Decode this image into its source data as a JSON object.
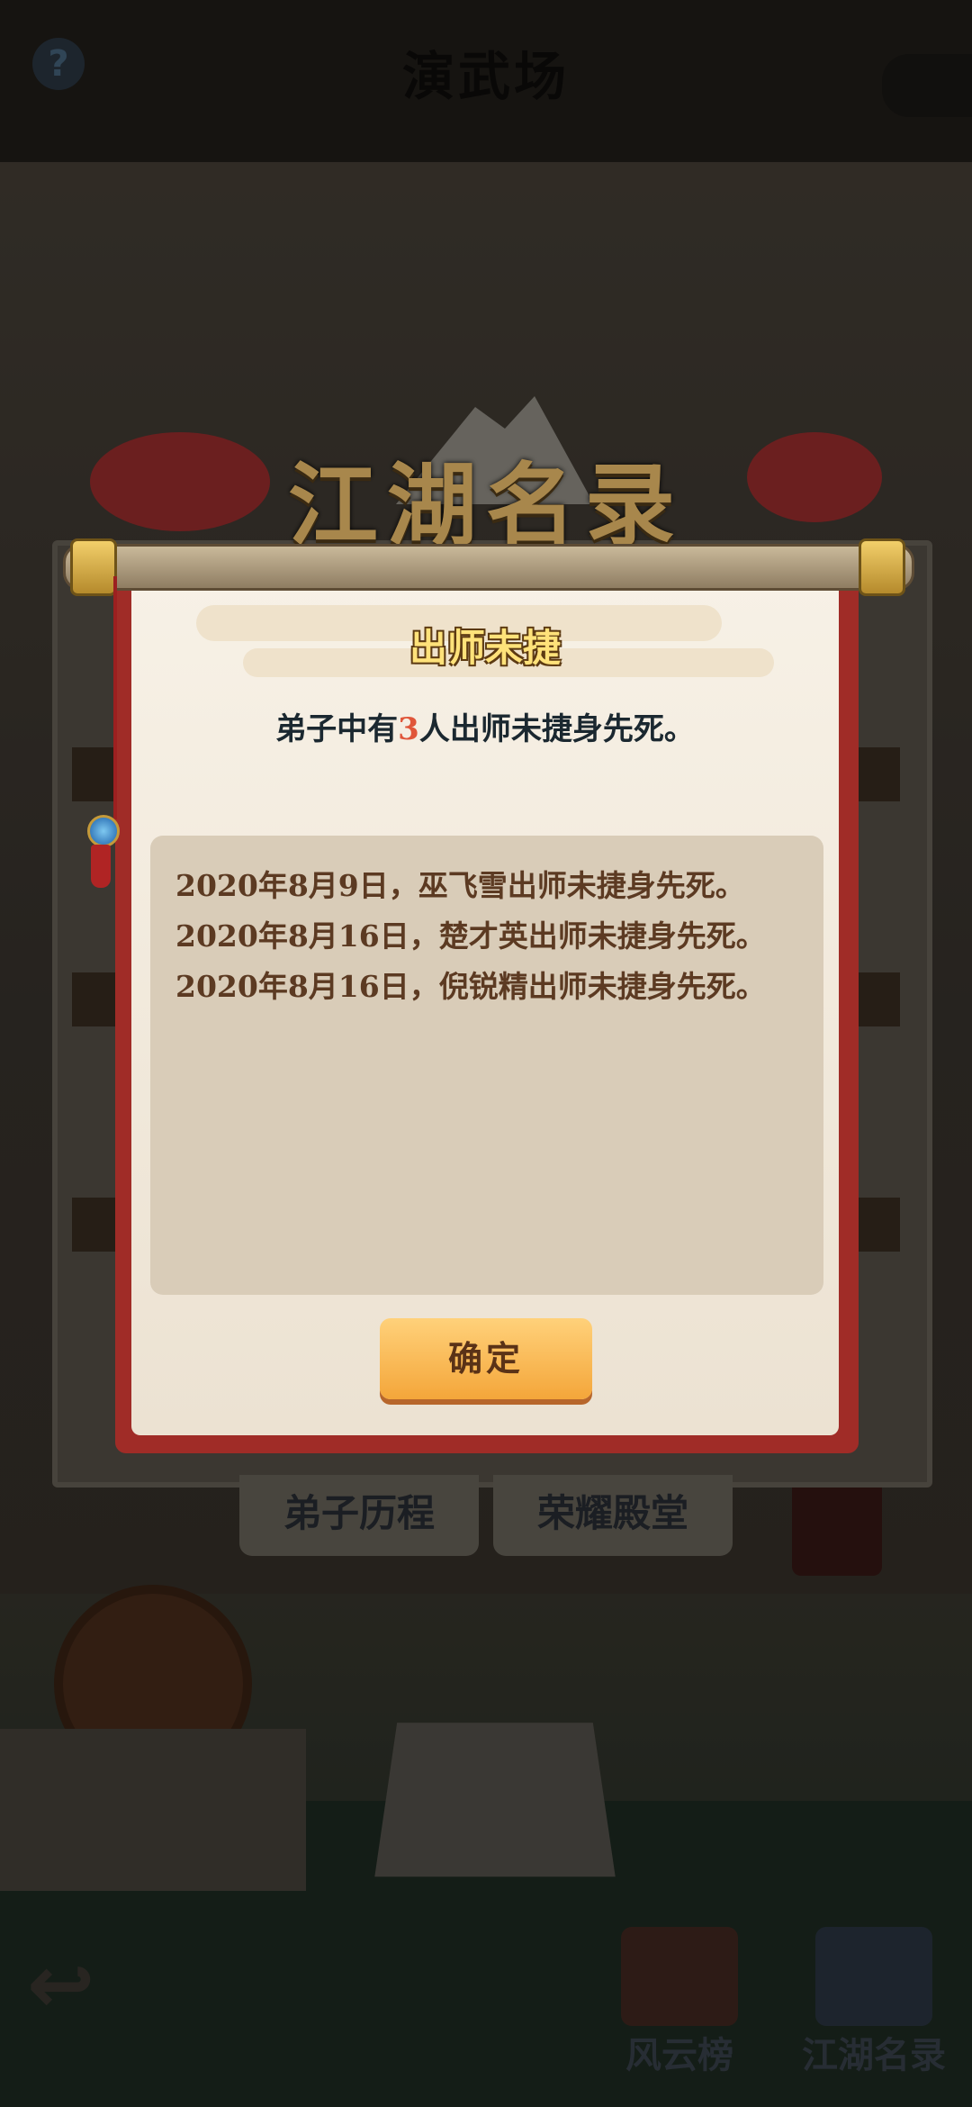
{
  "screen": {
    "top_title": "演武场",
    "help_icon": "?",
    "back_icon": "↩"
  },
  "background_panel": {
    "tabs": [
      "弟子历程",
      "荣耀殿堂"
    ]
  },
  "bottom_nav": [
    {
      "label": "风云榜",
      "icon": "scroll-list-icon"
    },
    {
      "label": "江湖名录",
      "icon": "book-icon"
    }
  ],
  "banner": {
    "title": "江湖名录"
  },
  "modal": {
    "title": "出师未捷",
    "summary_prefix": "弟子中有",
    "summary_count": "3",
    "summary_suffix": "人出师未捷身先死。",
    "records": [
      "2020年8月9日，巫飞雪出师未捷身先死。",
      "2020年8月16日，楚才英出师未捷身先死。",
      "2020年8月16日，倪锐精出师未捷身先死。"
    ],
    "confirm_label": "确定"
  },
  "colors": {
    "scroll_red": "#a02c27",
    "paper": "#f7f1e6",
    "record_text": "#5c3a22",
    "count_highlight": "#e0563a",
    "button_orange": "#f4a63a"
  }
}
